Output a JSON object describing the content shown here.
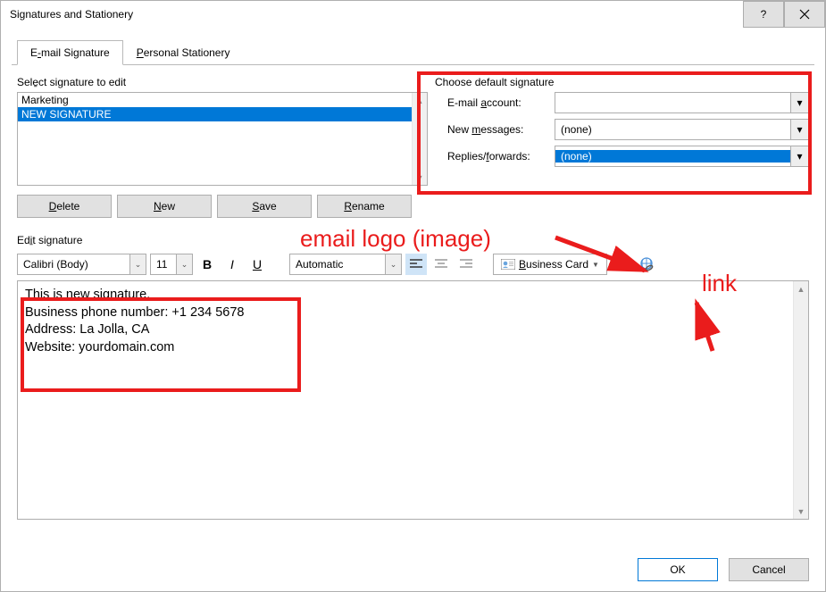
{
  "titlebar": {
    "title": "Signatures and Stationery"
  },
  "tabs": {
    "email_pre": "E",
    "email_u": "-",
    "email_post": "mail Signature",
    "stationery_pre": "",
    "stationery_u": "P",
    "stationery_post": "ersonal Stationery"
  },
  "select": {
    "label": "Sele̱ct signature to edit",
    "items": [
      "Marketing",
      "NEW SIGNATURE"
    ],
    "selected": 1
  },
  "buttons": {
    "delete_u": "D",
    "delete_post": "elete",
    "new_u": "N",
    "new_post": "ew",
    "save_u": "S",
    "save_post": "ave",
    "rename_u": "R",
    "rename_post": "ename"
  },
  "defaults": {
    "section": "Choose default signature",
    "email_label_pre": "E-mail ",
    "email_label_u": "a",
    "email_label_post": "ccount:",
    "email_value": "",
    "new_label_pre": "New ",
    "new_label_u": "m",
    "new_label_post": "essages:",
    "new_value": "(none)",
    "rf_label_pre": "Replies/",
    "rf_label_u": "f",
    "rf_label_post": "orwards:",
    "rf_value": "(none)"
  },
  "editsig": {
    "label": "Edi̱t signature",
    "font": "Calibri (Body)",
    "size": "11",
    "auto": "Automatic",
    "biz_u": "B",
    "biz_post": "usiness Card"
  },
  "editor": [
    "This is new signature.",
    "Business phone number: +1 234 5678",
    "Address: La Jolla, CA",
    "Website: yourdomain.com"
  ],
  "footer": {
    "ok": "OK",
    "cancel": "Cancel"
  },
  "anno": {
    "image": "email logo (image)",
    "link": "link"
  }
}
